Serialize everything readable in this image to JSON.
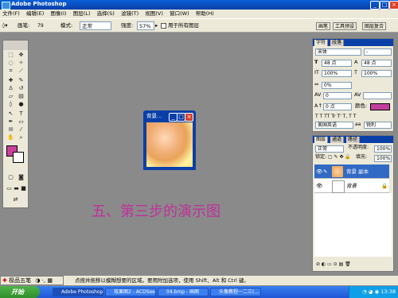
{
  "window": {
    "title": "Adobe Photoshop"
  },
  "menu": [
    "文件(F)",
    "编辑(E)",
    "图像(I)",
    "图层(L)",
    "选择(S)",
    "滤镜(T)",
    "视图(V)",
    "窗口(W)",
    "帮助(H)"
  ],
  "options": {
    "brush_label": "画笔:",
    "brush_size": "79",
    "mode_label": "模式:",
    "mode_value": "正常",
    "strength_label": "强度:",
    "strength_value": "57%",
    "all_layers_label": "用于所有图层",
    "tabs": [
      "画笔",
      "工具预设",
      "图层复合"
    ]
  },
  "document": {
    "title": "背景..."
  },
  "caption": "五、第三步的演示图",
  "char_panel": {
    "tabs": [
      "字符",
      "段落"
    ],
    "font": "宋体",
    "style": "-",
    "size": "48 点",
    "leading": "48 点",
    "vscale": "100%",
    "hscale": "100%",
    "tracking": "0%",
    "kerning": "0",
    "baseline": "0 点",
    "color_label": "颜色:",
    "language": "美国英语",
    "aa": "锐利"
  },
  "layers_panel": {
    "tabs": [
      "图层",
      "通道",
      "路径"
    ],
    "blend_mode": "正常",
    "opacity_label": "不透明度:",
    "opacity_value": "100%",
    "fill_label": "填充:",
    "fill_value": "100%",
    "layers": [
      {
        "name": "背景 副本",
        "selected": true
      },
      {
        "name": "背景",
        "selected": false
      }
    ]
  },
  "ime": {
    "label": "极品五笔"
  },
  "status": "点按并拖移以模糊想要的区域。要用附加选项，使用 Shift、Alt 和 Ctrl 键。",
  "taskbar": {
    "start": "开始",
    "tasks": [
      "Adobe Photoshop",
      "效果图2 - ACDSee...",
      "04.bmp - 画图",
      "头像教程一二三(..."
    ],
    "clock": "13:38"
  },
  "colors": {
    "foreground": "#c8409c",
    "background": "#ffffff",
    "text_color": "#c040a0"
  }
}
